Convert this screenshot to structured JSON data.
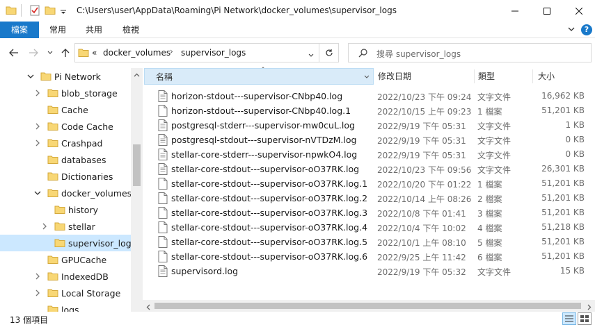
{
  "window": {
    "title": "C:\\Users\\user\\AppData\\Roaming\\Pi Network\\docker_volumes\\supervisor_logs",
    "qa_dropdown_icon": "chevron-down-icon"
  },
  "ribbon": {
    "tabs": [
      "檔案",
      "常用",
      "共用",
      "檢視"
    ],
    "file_tab_color": "#1979ca",
    "help_icon": "help-icon"
  },
  "address": {
    "overflow": "«",
    "crumbs": [
      "docker_volumes",
      "supervisor_logs"
    ]
  },
  "search": {
    "placeholder": "搜尋 supervisor_logs"
  },
  "sidebar": {
    "items": [
      {
        "label": "Pi Network",
        "indent": 1,
        "expanded": true
      },
      {
        "label": "blob_storage",
        "indent": 2,
        "expandable": true
      },
      {
        "label": "Cache",
        "indent": 2,
        "expandable": false
      },
      {
        "label": "Code Cache",
        "indent": 2,
        "expandable": true
      },
      {
        "label": "Crashpad",
        "indent": 2,
        "expandable": true
      },
      {
        "label": "databases",
        "indent": 2,
        "expandable": false
      },
      {
        "label": "Dictionaries",
        "indent": 2,
        "expandable": false
      },
      {
        "label": "docker_volumes",
        "indent": 2,
        "expanded": true
      },
      {
        "label": "history",
        "indent": 3,
        "expandable": false
      },
      {
        "label": "stellar",
        "indent": 3,
        "expandable": true
      },
      {
        "label": "supervisor_logs",
        "indent": 3,
        "expandable": false,
        "selected": true
      },
      {
        "label": "GPUCache",
        "indent": 2,
        "expandable": false
      },
      {
        "label": "IndexedDB",
        "indent": 2,
        "expandable": true
      },
      {
        "label": "Local Storage",
        "indent": 2,
        "expandable": true
      },
      {
        "label": "logs",
        "indent": 2,
        "expandable": false
      }
    ]
  },
  "columns": {
    "name": "名稱",
    "date": "修改日期",
    "type": "類型",
    "size": "大小"
  },
  "files": [
    {
      "name": "horizon-stdout---supervisor-CNbp40.log",
      "date": "2022/10/23 下午 09:24",
      "type": "文字文件",
      "size": "16,962 KB"
    },
    {
      "name": "horizon-stdout---supervisor-CNbp40.log.1",
      "date": "2022/10/15 上午 09:23",
      "type": "1 檔案",
      "size": "51,201 KB"
    },
    {
      "name": "postgresql-stderr---supervisor-mw0cuL.log",
      "date": "2022/9/19 下午 05:31",
      "type": "文字文件",
      "size": "1 KB"
    },
    {
      "name": "postgresql-stdout---supervisor-nVTDzM.log",
      "date": "2022/9/19 下午 05:31",
      "type": "文字文件",
      "size": "0 KB"
    },
    {
      "name": "stellar-core-stderr---supervisor-npwkO4.log",
      "date": "2022/9/19 下午 05:31",
      "type": "文字文件",
      "size": "0 KB"
    },
    {
      "name": "stellar-core-stdout---supervisor-oO37RK.log",
      "date": "2022/10/23 下午 09:56",
      "type": "文字文件",
      "size": "26,301 KB"
    },
    {
      "name": "stellar-core-stdout---supervisor-oO37RK.log.1",
      "date": "2022/10/20 下午 01:22",
      "type": "1 檔案",
      "size": "51,201 KB"
    },
    {
      "name": "stellar-core-stdout---supervisor-oO37RK.log.2",
      "date": "2022/10/14 上午 08:26",
      "type": "2 檔案",
      "size": "51,201 KB"
    },
    {
      "name": "stellar-core-stdout---supervisor-oO37RK.log.3",
      "date": "2022/10/8 下午 01:41",
      "type": "3 檔案",
      "size": "51,201 KB"
    },
    {
      "name": "stellar-core-stdout---supervisor-oO37RK.log.4",
      "date": "2022/10/4 下午 10:02",
      "type": "4 檔案",
      "size": "51,218 KB"
    },
    {
      "name": "stellar-core-stdout---supervisor-oO37RK.log.5",
      "date": "2022/10/1 上午 08:10",
      "type": "5 檔案",
      "size": "51,201 KB"
    },
    {
      "name": "stellar-core-stdout---supervisor-oO37RK.log.6",
      "date": "2022/9/25 上午 11:42",
      "type": "6 檔案",
      "size": "51,201 KB"
    },
    {
      "name": "supervisord.log",
      "date": "2022/9/19 下午 05:32",
      "type": "文字文件",
      "size": "15 KB"
    }
  ],
  "status": {
    "count": "13 個項目"
  },
  "colors": {
    "selection": "#cce8ff",
    "folder": "#f8d775",
    "accent": "#1979ca"
  }
}
